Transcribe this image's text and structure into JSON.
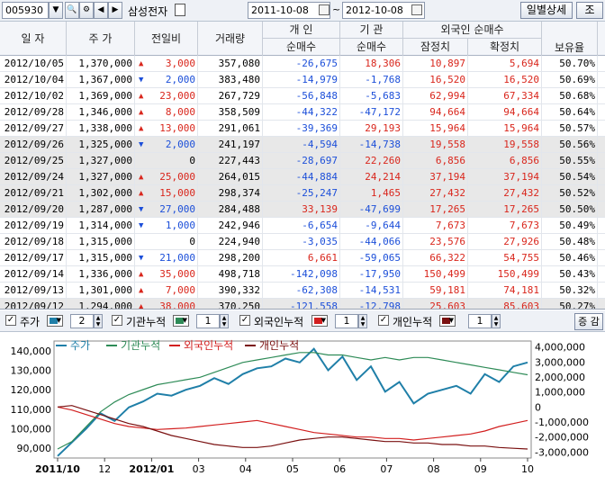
{
  "toolbar": {
    "code": "005930",
    "name": "삼성전자",
    "date_from": "2011-10-08",
    "tilde": "~",
    "date_to": "2012-10-08",
    "detail_btn": "일별상세",
    "query_btn": "조"
  },
  "grid": {
    "headers": {
      "date": "일 자",
      "price": "주 가",
      "change": "전일비",
      "volume": "거래량",
      "ind_top": "개 인",
      "ind_bot": "순매수",
      "inst_top": "기 관",
      "inst_bot": "순매수",
      "for_top": "외국인 순매수",
      "prov": "잠정치",
      "conf": "확정치",
      "hold": "보유율"
    },
    "rows": [
      [
        "2012/10/05",
        "1,370,000",
        "up",
        "3,000",
        "357,080",
        "-26,675",
        "18,306",
        "10,897",
        "5,694",
        "50.70%"
      ],
      [
        "2012/10/04",
        "1,367,000",
        "down",
        "2,000",
        "383,480",
        "-14,979",
        "-1,768",
        "16,520",
        "16,520",
        "50.69%"
      ],
      [
        "2012/10/02",
        "1,369,000",
        "up",
        "23,000",
        "267,729",
        "-56,848",
        "-5,683",
        "62,994",
        "67,334",
        "50.68%"
      ],
      [
        "2012/09/28",
        "1,346,000",
        "up",
        "8,000",
        "358,509",
        "-44,322",
        "-47,172",
        "94,664",
        "94,664",
        "50.64%"
      ],
      [
        "2012/09/27",
        "1,338,000",
        "up",
        "13,000",
        "291,061",
        "-39,369",
        "29,193",
        "15,964",
        "15,964",
        "50.57%"
      ],
      [
        "2012/09/26",
        "1,325,000",
        "down",
        "2,000",
        "241,197",
        "-4,594",
        "-14,738",
        "19,558",
        "19,558",
        "50.56%"
      ],
      [
        "2012/09/25",
        "1,327,000",
        "none",
        "0",
        "227,443",
        "-28,697",
        "22,260",
        "6,856",
        "6,856",
        "50.55%"
      ],
      [
        "2012/09/24",
        "1,327,000",
        "up",
        "25,000",
        "264,015",
        "-44,884",
        "24,214",
        "37,194",
        "37,194",
        "50.54%"
      ],
      [
        "2012/09/21",
        "1,302,000",
        "up",
        "15,000",
        "298,374",
        "-25,247",
        "1,465",
        "27,432",
        "27,432",
        "50.52%"
      ],
      [
        "2012/09/20",
        "1,287,000",
        "down",
        "27,000",
        "284,488",
        "33,139",
        "-47,699",
        "17,265",
        "17,265",
        "50.50%"
      ],
      [
        "2012/09/19",
        "1,314,000",
        "down",
        "1,000",
        "242,946",
        "-6,654",
        "-9,644",
        "7,673",
        "7,673",
        "50.49%"
      ],
      [
        "2012/09/18",
        "1,315,000",
        "none",
        "0",
        "224,940",
        "-3,035",
        "-44,066",
        "23,576",
        "27,926",
        "50.48%"
      ],
      [
        "2012/09/17",
        "1,315,000",
        "down",
        "21,000",
        "298,200",
        "6,661",
        "-59,065",
        "66,322",
        "54,755",
        "50.46%"
      ],
      [
        "2012/09/14",
        "1,336,000",
        "up",
        "35,000",
        "498,718",
        "-142,098",
        "-17,950",
        "150,499",
        "150,499",
        "50.43%"
      ],
      [
        "2012/09/13",
        "1,301,000",
        "up",
        "7,000",
        "390,332",
        "-62,308",
        "-14,531",
        "59,181",
        "74,181",
        "50.32%"
      ],
      [
        "2012/09/12",
        "1,294,000",
        "up",
        "38,000",
        "370,250",
        "-121,558",
        "-12,798",
        "25,603",
        "85,603",
        "50.27%"
      ]
    ]
  },
  "controls": {
    "price": "주가",
    "inst": "기관누적",
    "foreign": "외국인누적",
    "indiv": "개인누적",
    "price_w": "2",
    "inst_w": "1",
    "foreign_w": "1",
    "indiv_w": "1",
    "zoom_btn": "증 감"
  },
  "colors": {
    "price": "#1f7fa8",
    "inst": "#2e8b57",
    "foreign": "#d21f1f",
    "indiv": "#7a1010"
  },
  "chart_data": {
    "type": "line",
    "legend": [
      "주가",
      "기관누적",
      "외국인누적",
      "개인누적"
    ],
    "x_labels": [
      "2011/10",
      "12",
      "2012/01",
      "03",
      "04",
      "05",
      "06",
      "07",
      "08",
      "09",
      "10"
    ],
    "y_left": {
      "ticks": [
        "140,000",
        "130,000",
        "120,000",
        "110,000",
        "100,000",
        "90,000"
      ],
      "range": [
        85000,
        145000
      ]
    },
    "y_right": {
      "ticks": [
        "4,000,000",
        "3,000,000",
        "2,000,000",
        "1,000,000",
        "0",
        "-1,000,000",
        "-2,000,000",
        "-3,000,000"
      ],
      "range": [
        -3400000,
        4400000
      ]
    },
    "series": [
      {
        "name": "주가",
        "axis": "left",
        "values": [
          86000,
          93000,
          100000,
          108000,
          104000,
          111000,
          114000,
          118000,
          117000,
          120000,
          122000,
          126000,
          123000,
          128000,
          131000,
          132000,
          136000,
          134000,
          141000,
          130000,
          137000,
          125000,
          132000,
          119000,
          124000,
          113000,
          118000,
          120000,
          122000,
          118000,
          128000,
          124000,
          132000,
          134000
        ]
      },
      {
        "name": "기관누적",
        "axis": "left_dummy",
        "values": [
          0,
          300000,
          900000,
          1500000,
          1900000,
          2200000,
          2400000,
          2600000,
          2700000,
          2800000,
          2900000,
          3100000,
          3300000,
          3500000,
          3600000,
          3700000,
          3800000,
          3900000,
          3900000,
          3800000,
          3800000,
          3700000,
          3600000,
          3700000,
          3600000,
          3700000,
          3700000,
          3600000,
          3500000,
          3400000,
          3300000,
          3200000,
          3100000,
          3000000
        ]
      },
      {
        "name": "외국인누적",
        "axis": "right",
        "values": [
          0,
          -200000,
          -500000,
          -800000,
          -1100000,
          -1300000,
          -1400000,
          -1500000,
          -1450000,
          -1400000,
          -1300000,
          -1200000,
          -1100000,
          -1000000,
          -900000,
          -1100000,
          -1300000,
          -1500000,
          -1700000,
          -1800000,
          -1900000,
          -2000000,
          -2000000,
          -2100000,
          -2100000,
          -2200000,
          -2100000,
          -2000000,
          -1900000,
          -1800000,
          -1600000,
          -1300000,
          -1100000,
          -900000
        ]
      },
      {
        "name": "개인누적",
        "axis": "right",
        "values": [
          0,
          100000,
          -200000,
          -500000,
          -800000,
          -1100000,
          -1300000,
          -1600000,
          -1900000,
          -2100000,
          -2300000,
          -2500000,
          -2600000,
          -2700000,
          -2700000,
          -2600000,
          -2400000,
          -2200000,
          -2100000,
          -2000000,
          -2000000,
          -2100000,
          -2200000,
          -2300000,
          -2300000,
          -2400000,
          -2400000,
          -2500000,
          -2500000,
          -2600000,
          -2600000,
          -2700000,
          -2750000,
          -2800000
        ]
      }
    ]
  }
}
